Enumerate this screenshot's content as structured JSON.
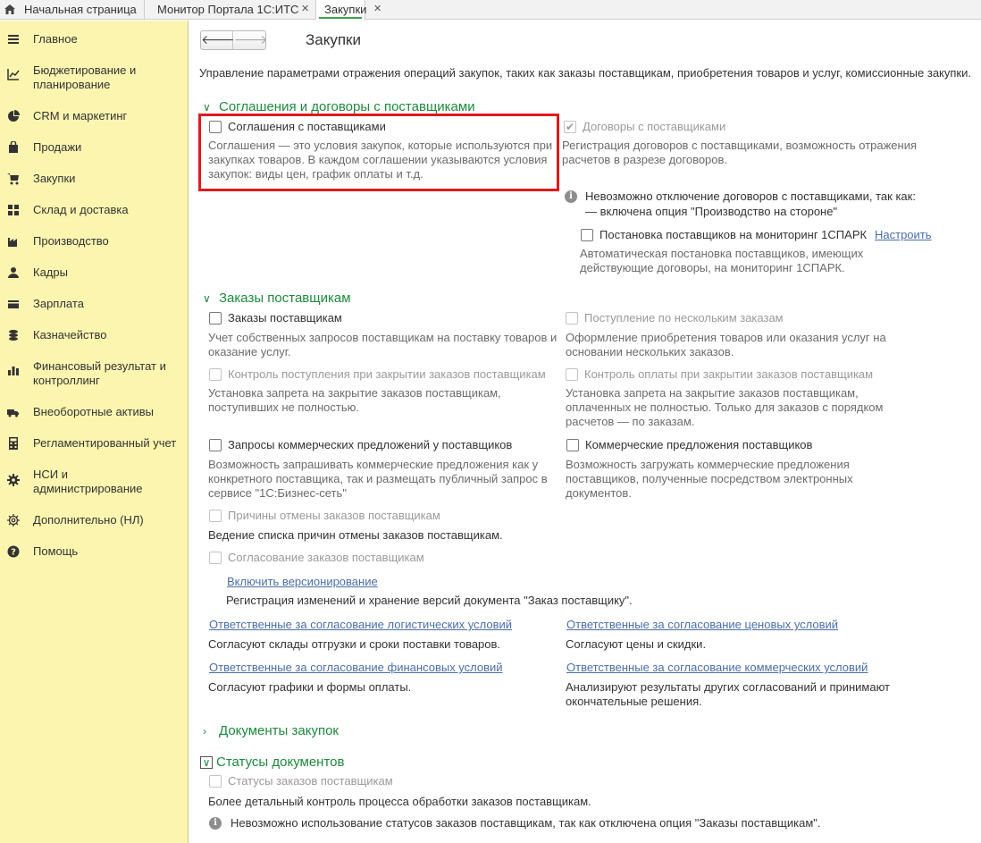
{
  "tabs": {
    "home": "Начальная страница",
    "monitor": "Монитор Портала 1С:ИТС",
    "purchases": "Закупки"
  },
  "sidebar": {
    "items": [
      {
        "label": "Главное",
        "icon": "menu-icon"
      },
      {
        "label": "Бюджетирование и планирование",
        "icon": "chart-icon"
      },
      {
        "label": "CRM и маркетинг",
        "icon": "pie-icon"
      },
      {
        "label": "Продажи",
        "icon": "bag-icon"
      },
      {
        "label": "Закупки",
        "icon": "cart-icon"
      },
      {
        "label": "Склад и доставка",
        "icon": "grid-icon"
      },
      {
        "label": "Производство",
        "icon": "factory-icon"
      },
      {
        "label": "Кадры",
        "icon": "person-icon"
      },
      {
        "label": "Зарплата",
        "icon": "wallet-icon"
      },
      {
        "label": "Казначейство",
        "icon": "coins-icon"
      },
      {
        "label": "Финансовый результат и контроллинг",
        "icon": "bars-icon"
      },
      {
        "label": "Внеоборотные активы",
        "icon": "truck-icon"
      },
      {
        "label": "Регламентированный учет",
        "icon": "calculator-icon"
      },
      {
        "label": "НСИ и администрирование",
        "icon": "gear-icon"
      },
      {
        "label": "Дополнительно (НЛ)",
        "icon": "gear-outline-icon"
      },
      {
        "label": "Помощь",
        "icon": "help-icon"
      }
    ]
  },
  "nav": {
    "back": "🡐",
    "forward": "🡒"
  },
  "page": {
    "title": "Закупки",
    "description": "Управление параметрами отражения операций закупок, таких как заказы поставщикам, приобретения товаров и услуг, комиссионные закупки."
  },
  "agreements": {
    "title": "Соглашения и договоры с поставщиками",
    "agreements_label": "Соглашения с поставщиками",
    "agreements_desc": [
      "Соглашения — это условия закупок, которые используются при",
      "закупках товаров. В каждом соглашении указываются условия",
      "закупок: виды цен, график оплаты и т.д."
    ],
    "contracts_label": "Договоры с поставщиками",
    "contracts_desc": [
      "Регистрация договоров с поставщиками, возможность отражения",
      "расчетов в разрезе договоров."
    ],
    "info_lines": [
      "Невозможно отключение договоров с поставщиками, так как:",
      "— включена опция \"Производство на стороне\""
    ],
    "monitoring_label": "Постановка поставщиков на мониторинг 1СПАРК",
    "monitoring_link": "Настроить",
    "monitoring_desc": [
      "Автоматическая постановка поставщиков, имеющих",
      "действующие договоры, на мониторинг 1СПАРК."
    ]
  },
  "orders": {
    "title": "Заказы поставщикам",
    "orders_label": "Заказы поставщикам",
    "orders_desc": [
      "Учет собственных запросов поставщикам на поставку товаров и",
      "оказание услуг."
    ],
    "multi_label": "Поступление по нескольким заказам",
    "multi_desc": [
      "Оформление приобретения товаров или оказания услуг на",
      "основании нескольких заказов."
    ],
    "receipt_ctrl_label": "Контроль поступления при закрытии заказов поставщикам",
    "receipt_ctrl_desc": [
      "Установка запрета на закрытие заказов поставщикам,",
      "поступивших не полностью."
    ],
    "payment_ctrl_label": "Контроль оплаты при закрытии заказов поставщикам",
    "payment_ctrl_desc": [
      "Установка запрета на закрытие заказов поставщикам,",
      "оплаченных не полностью. Только для заказов с порядком",
      "расчетов — по заказам."
    ],
    "rfq_label": "Запросы коммерческих предложений у поставщиков",
    "rfq_desc": [
      "Возможность запрашивать коммерческие предложения как у",
      "конкретного поставщика, так и размещать публичный запрос в",
      "сервисе \"1С:Бизнес-сеть\""
    ],
    "offers_label": "Коммерческие предложения поставщиков",
    "offers_desc": [
      "Возможность загружать коммерческие предложения",
      "поставщиков, полученные посредством электронных",
      "документов."
    ],
    "cancel_label": "Причины отмены заказов поставщикам",
    "cancel_desc": "Ведение списка причин отмены заказов поставщикам.",
    "approval_label": "Согласование заказов поставщикам",
    "versioning_link": "Включить версионирование",
    "versioning_desc": "Регистрация изменений и хранение версий документа \"Заказ поставщику\".",
    "resp_logistic_link": "Ответственные за согласование логистических условий",
    "resp_logistic_desc": "Согласуют склады отгрузки и сроки поставки товаров.",
    "resp_price_link": "Ответственные за согласование ценовых условий",
    "resp_price_desc": "Согласуют цены и скидки.",
    "resp_fin_link": "Ответственные за согласование финансовых условий",
    "resp_fin_desc": "Согласуют графики и формы оплаты.",
    "resp_comm_link": "Ответственные за согласование коммерческих условий",
    "resp_comm_desc": [
      "Анализируют результаты других согласований и принимают",
      "окончательные решения."
    ]
  },
  "documents": {
    "title": "Документы закупок"
  },
  "statuses": {
    "title": "Статусы документов",
    "status_label": "Статусы заказов поставщикам",
    "status_desc": "Более детальный контроль процесса обработки заказов поставщикам.",
    "info": "Невозможно использование статусов заказов поставщикам, так как отключена опция \"Заказы поставщикам\"."
  }
}
